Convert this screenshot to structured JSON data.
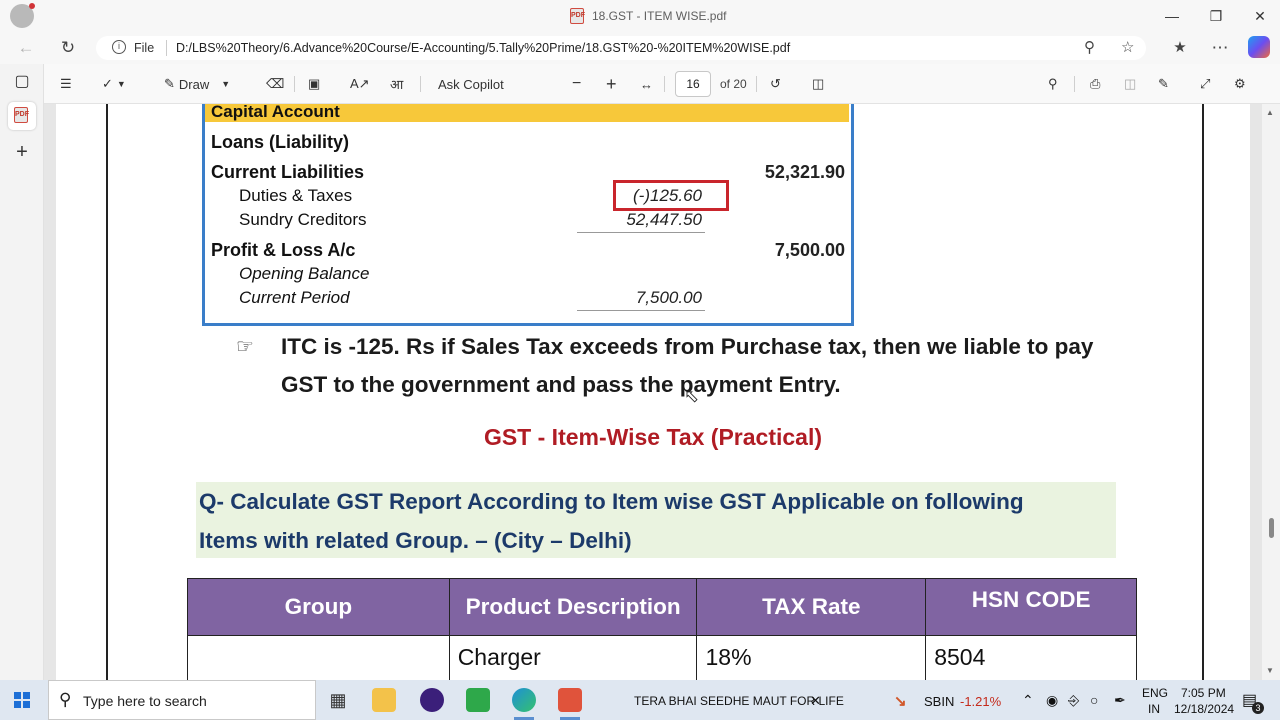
{
  "browser": {
    "tab_title": "18.GST - ITEM WISE.pdf",
    "file_label": "File",
    "url": "D:/LBS%20Theory/6.Advance%20Course/E-Accounting/5.Tally%20Prime/18.GST%20-%20ITEM%20WISE.pdf"
  },
  "pdf_toolbar": {
    "draw_label": "Draw",
    "ask_copilot_label": "Ask Copilot",
    "page_current": "16",
    "page_total": "of 20"
  },
  "tally": {
    "capital_account": "Capital Account",
    "loans": "Loans (Liability)",
    "current_liabilities": "Current Liabilities",
    "current_liabilities_amount": "52,321.90",
    "duties_taxes": "Duties & Taxes",
    "duties_taxes_amount": "(-)125.60",
    "sundry_creditors": "Sundry Creditors",
    "sundry_creditors_amount": "52,447.50",
    "profit_loss": "Profit & Loss A/c",
    "profit_loss_amount": "7,500.00",
    "opening_balance": "Opening Balance",
    "current_period": "Current Period",
    "current_period_amount": "7,500.00"
  },
  "content": {
    "bullet_icon": "pointing-hand-icon",
    "bullet_text": "ITC is -125. Rs if Sales Tax exceeds from Purchase tax, then we liable to pay GST to the government and pass the payment Entry.",
    "practical_heading": "GST - Item-Wise Tax (Practical)",
    "question_line1": "Q- Calculate GST Report According to Item wise GST Applicable on following",
    "question_line2": "Items with related Group. – (City – Delhi)"
  },
  "gst_table": {
    "headers": [
      "Group",
      "Product Description",
      "TAX Rate",
      "HSN CODE"
    ],
    "rows": [
      [
        "",
        "Charger",
        "18%",
        "8504"
      ]
    ]
  },
  "taskbar": {
    "search_placeholder": "Type here to search",
    "media_title": "TERA BHAI SEEDHE MAUT FOR LIFE",
    "stock_name": "SBIN",
    "stock_change": "-1.21%",
    "language": "ENG",
    "region": "IN",
    "time": "7:05 PM",
    "date": "12/18/2024",
    "notification_count": "3"
  },
  "colors": {
    "capital_bar": "#f7c83a",
    "tally_border": "#3a7ec9",
    "highlight_box": "#c9252c",
    "heading_red": "#b01c24",
    "question_bg": "#eaf3e0",
    "question_text": "#1c3a6a",
    "table_header": "#8064a2",
    "stock_negative": "#c42b1c"
  }
}
